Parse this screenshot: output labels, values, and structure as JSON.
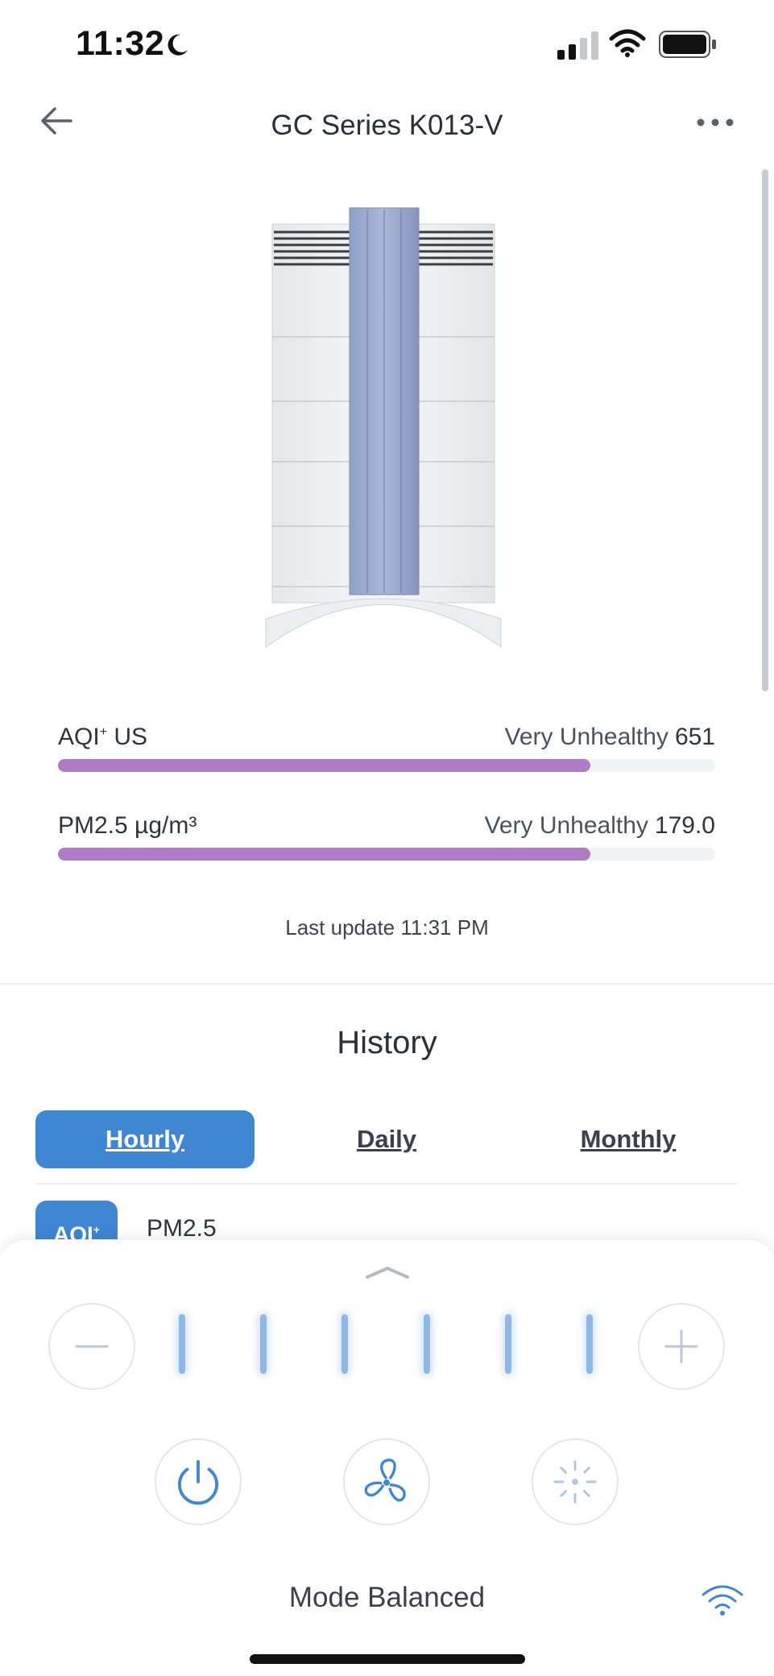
{
  "status": {
    "time": "11:32",
    "icons": [
      "moon-icon",
      "signal-icon",
      "wifi-icon",
      "battery-icon"
    ]
  },
  "header": {
    "title": "GC Series K013-V",
    "back_icon": "arrow-left-icon",
    "menu_icon": "more-dots-icon"
  },
  "metrics": [
    {
      "label": "AQI",
      "label_sup": "+",
      "label_suffix": " US",
      "status": "Very Unhealthy",
      "value": "651",
      "level": 0.81
    },
    {
      "label": "PM2.5 µg/m³",
      "status": "Very Unhealthy",
      "value": "179.0",
      "level": 0.81
    }
  ],
  "last_update": "Last update 11:31 PM",
  "history": {
    "title": "History",
    "tabs": [
      {
        "label": "Hourly",
        "active": true
      },
      {
        "label": "Daily",
        "active": false
      },
      {
        "label": "Monthly",
        "active": false
      }
    ],
    "chip_aqi": "AQI",
    "chip_aqi_sup": "+",
    "chip_pm": "PM2.5"
  },
  "controls": {
    "fan_speed_levels": 6,
    "mode_label": "Mode Balanced",
    "colors": {
      "accent": "#3f86d3",
      "tick": "#8fb8e6",
      "bar": "#b07cc6"
    }
  }
}
